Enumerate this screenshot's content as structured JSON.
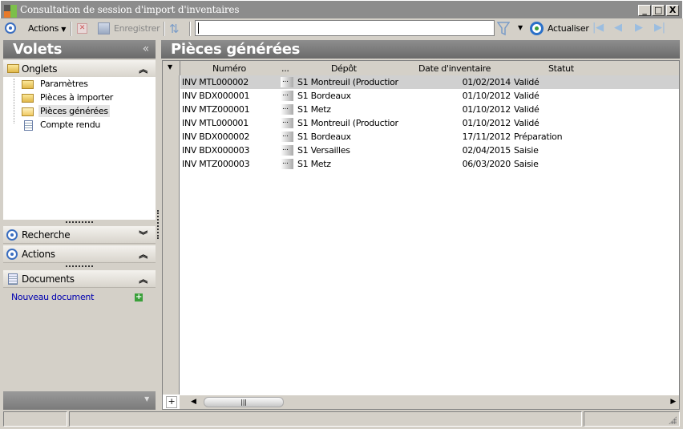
{
  "window": {
    "title": "Consultation de session d'import d'inventaires",
    "minimize": "_",
    "maximize": "□",
    "close": "X"
  },
  "toolbar": {
    "actions_label": "Actions",
    "save_label": "Enregistrer",
    "search_value": "",
    "refresh_label": "Actualiser"
  },
  "left_pane": {
    "title": "Volets",
    "collapse": "«",
    "onglets": {
      "label": "Onglets",
      "items": [
        "Paramètres",
        "Pièces à importer",
        "Pièces générées",
        "Compte rendu"
      ],
      "selected": "Pièces générées"
    },
    "recherche": {
      "label": "Recherche"
    },
    "actions": {
      "label": "Actions"
    },
    "documents": {
      "label": "Documents",
      "new_doc": "Nouveau document"
    }
  },
  "main": {
    "title": "Pièces générées",
    "columns": [
      "Numéro",
      "...",
      "Dépôt",
      "Date d'inventaire",
      "Statut"
    ],
    "rows": [
      {
        "numero": "INV MTL000002",
        "dots": "...",
        "depot": "S1 Montreuil (Productior",
        "date": "01/02/2014",
        "statut": "Validé"
      },
      {
        "numero": "INV BDX000001",
        "dots": "...",
        "depot": "S1 Bordeaux",
        "date": "01/10/2012",
        "statut": "Validé"
      },
      {
        "numero": "INV MTZ000001",
        "dots": "...",
        "depot": "S1 Metz",
        "date": "01/10/2012",
        "statut": "Validé"
      },
      {
        "numero": "INV MTL000001",
        "dots": "...",
        "depot": "S1 Montreuil (Productior",
        "date": "01/10/2012",
        "statut": "Validé"
      },
      {
        "numero": "INV BDX000002",
        "dots": "...",
        "depot": "S1 Bordeaux",
        "date": "17/11/2012",
        "statut": "Préparation"
      },
      {
        "numero": "INV BDX000003",
        "dots": "...",
        "depot": "S1 Versailles",
        "date": "02/04/2015",
        "statut": "Saisie"
      },
      {
        "numero": "INV MTZ000003",
        "dots": "...",
        "depot": "S1 Metz",
        "date": "06/03/2020",
        "statut": "Saisie"
      }
    ],
    "add_row": "+"
  }
}
